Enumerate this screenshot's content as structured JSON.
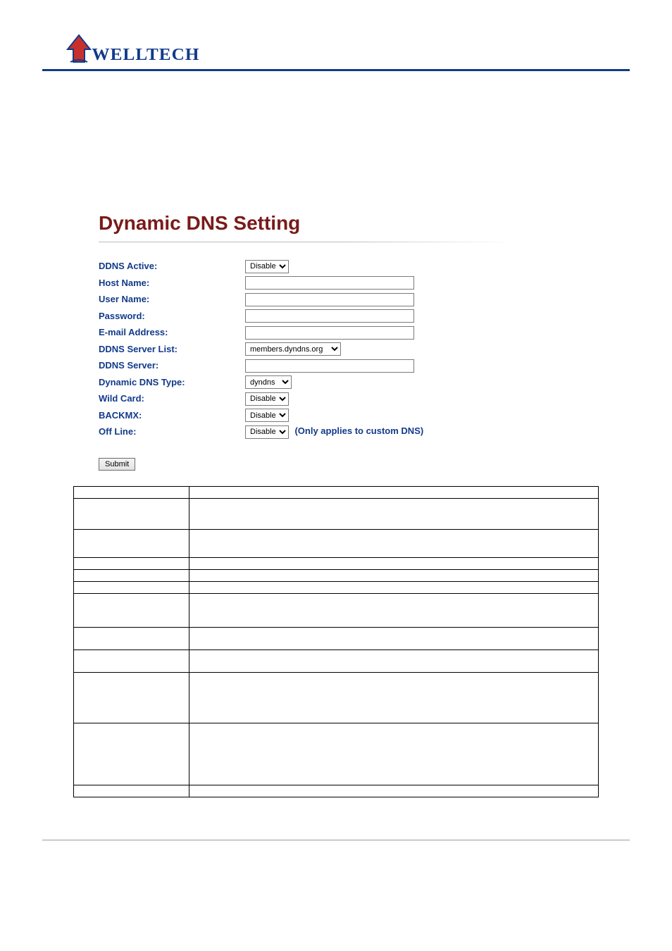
{
  "brand": {
    "name": "WELLTECH"
  },
  "page_title": "Dynamic DNS Setting",
  "form": {
    "ddns_active": {
      "label": "DDNS Active:",
      "value": "Disable"
    },
    "host_name": {
      "label": "Host Name:",
      "value": ""
    },
    "user_name": {
      "label": "User Name:",
      "value": ""
    },
    "password": {
      "label": "Password:",
      "value": ""
    },
    "email": {
      "label": "E-mail Address:",
      "value": ""
    },
    "server_list": {
      "label": "DDNS Server List:",
      "value": "members.dyndns.org"
    },
    "ddns_server": {
      "label": "DDNS Server:",
      "value": ""
    },
    "dns_type": {
      "label": "Dynamic DNS Type:",
      "value": "dyndns"
    },
    "wild_card": {
      "label": "Wild Card:",
      "value": "Disable"
    },
    "backmx": {
      "label": "BACKMX:",
      "value": "Disable"
    },
    "off_line": {
      "label": "Off Line:",
      "value": "Disable",
      "note": "(Only applies to custom DNS)"
    }
  },
  "submit_label": "Submit",
  "desc_rows": [
    {
      "field": "",
      "desc": "",
      "cls": "h0"
    },
    {
      "field": "",
      "desc": ""
    },
    {
      "field": "",
      "desc": ""
    },
    {
      "field": "",
      "desc": "",
      "cls": "h0"
    },
    {
      "field": "",
      "desc": "",
      "cls": "h0"
    },
    {
      "field": "",
      "desc": "",
      "cls": "h0"
    },
    {
      "field": "",
      "desc": "",
      "link": ""
    },
    {
      "field": "",
      "desc": ""
    },
    {
      "field": "",
      "desc": ""
    },
    {
      "field": "",
      "desc": ""
    },
    {
      "field": "",
      "desc": ""
    },
    {
      "field": "",
      "desc": "",
      "cls": "h0"
    }
  ]
}
